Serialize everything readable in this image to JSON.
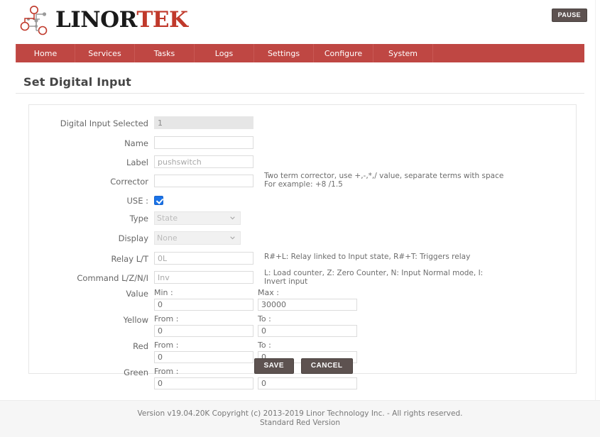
{
  "brand": {
    "name_dark": "LINOR",
    "name_accent": "TEK",
    "accent_color": "#c0392b",
    "logo_icon": "circuit-node-logo"
  },
  "header": {
    "pause_label": "PAUSE"
  },
  "nav": {
    "bg_color": "#bf4743",
    "items": [
      {
        "label": "Home"
      },
      {
        "label": "Services"
      },
      {
        "label": "Tasks"
      },
      {
        "label": "Logs"
      },
      {
        "label": "Settings"
      },
      {
        "label": "Configure"
      },
      {
        "label": "System"
      }
    ]
  },
  "page": {
    "title": "Set Digital Input"
  },
  "form": {
    "fields": [
      {
        "label": "Digital Input Selected",
        "value": "1",
        "placeholder": "",
        "disabled": true
      },
      {
        "label": "Name",
        "value": "",
        "placeholder": "",
        "disabled": false
      },
      {
        "label": "Label",
        "value": "",
        "placeholder": "pushswitch",
        "disabled": false
      },
      {
        "label": "Corrector",
        "value": "",
        "placeholder": "",
        "disabled": false,
        "hint_line1": "Two term corrector, use +,-,*,/ value, separate terms with space",
        "hint_line2": "For example: +8 /1.5"
      }
    ],
    "use": {
      "label": "USE :",
      "checked": true
    },
    "type": {
      "label": "Type",
      "selected": "State"
    },
    "display": {
      "label": "Display",
      "selected": "None"
    },
    "relay": {
      "label": "Relay L/T",
      "value": "",
      "placeholder": "0L",
      "hint": "R#+L: Relay linked to Input state, R#+T: Triggers relay"
    },
    "command": {
      "label": "Command L/Z/N/I",
      "value": "",
      "placeholder": "Inv",
      "hint_line1": "L: Load counter, Z: Zero Counter, N: Input Normal mode, I:",
      "hint_line2": "Invert input"
    },
    "ranges": [
      {
        "label": "Value",
        "left_label": "Min :",
        "left_value": "0",
        "right_label": "Max :",
        "right_value": "30000"
      },
      {
        "label": "Yellow",
        "left_label": "From :",
        "left_value": "0",
        "right_label": "To :",
        "right_value": "0"
      },
      {
        "label": "Red",
        "left_label": "From :",
        "left_value": "0",
        "right_label": "To :",
        "right_value": "0"
      },
      {
        "label": "Green",
        "left_label": "From :",
        "left_value": "0",
        "right_label": "To :",
        "right_value": "0"
      }
    ],
    "buttons": {
      "save": "SAVE",
      "cancel": "CANCEL"
    }
  },
  "footer": {
    "line1": "Version v19.04.20K Copyright (c) 2013-2019 Linor Technology Inc. - All rights reserved.",
    "line2": "Standard Red Version"
  }
}
